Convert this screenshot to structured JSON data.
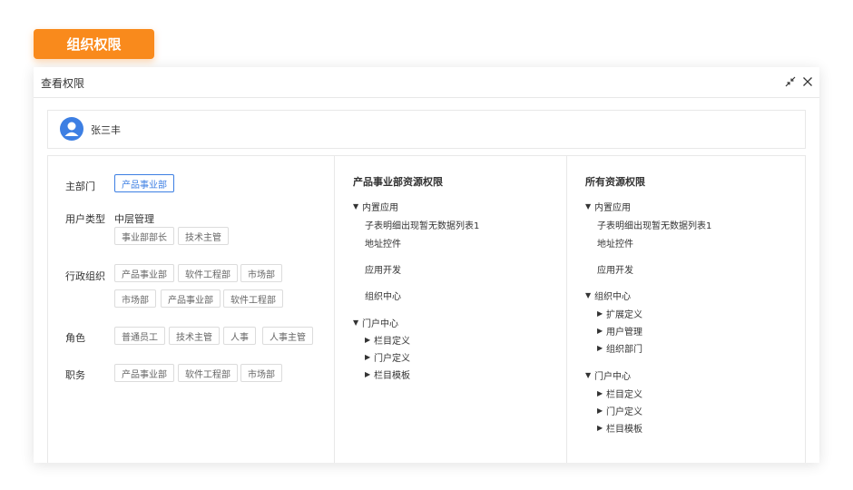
{
  "badge": {
    "label": "组织权限",
    "color": "#f98a1c"
  },
  "dialog": {
    "title": "查看权限",
    "collapse_icon": "collapse-arrows-icon",
    "close_icon": "close-icon"
  },
  "user": {
    "name": "张三丰",
    "avatar_icon": "user-avatar-icon",
    "avatar_color": "#3d7fe3"
  },
  "profile": {
    "main_dept": {
      "label": "主部门",
      "tag": "产品事业部"
    },
    "user_type": {
      "label": "用户类型",
      "value": "中层管理",
      "tags": [
        "事业部部长",
        "技术主管"
      ]
    },
    "admin_org": {
      "label": "行政组织",
      "tags": [
        "产品事业部",
        "软件工程部",
        "市场部",
        "市场部",
        "产品事业部",
        "软件工程部"
      ]
    },
    "role": {
      "label": "角色",
      "tags": [
        "普通员工",
        "技术主管",
        "人事",
        "人事主管"
      ]
    },
    "duty": {
      "label": "职务",
      "tags": [
        "产品事业部",
        "软件工程部",
        "市场部"
      ]
    }
  },
  "dept_resources": {
    "title": "产品事业部资源权限",
    "items": [
      {
        "label": "内置应用",
        "caret": "down"
      },
      {
        "label": "子表明细出现暂无数据列表1",
        "caret": ""
      },
      {
        "label": "地址控件",
        "caret": ""
      },
      {
        "label": "应用开发",
        "caret": ""
      },
      {
        "label": "组织中心",
        "caret": ""
      },
      {
        "label": "门户中心",
        "caret": "down"
      },
      {
        "label": "栏目定义",
        "caret": "right"
      },
      {
        "label": "门户定义",
        "caret": "right"
      },
      {
        "label": "栏目模板",
        "caret": "right"
      }
    ]
  },
  "all_resources": {
    "title": "所有资源权限",
    "items": [
      {
        "label": "内置应用",
        "caret": "down"
      },
      {
        "label": "子表明细出现暂无数据列表1",
        "caret": ""
      },
      {
        "label": "地址控件",
        "caret": ""
      },
      {
        "label": "应用开发",
        "caret": ""
      },
      {
        "label": "组织中心",
        "caret": "down"
      },
      {
        "label": "扩展定义",
        "caret": "right"
      },
      {
        "label": "用户管理",
        "caret": "right"
      },
      {
        "label": "组织部门",
        "caret": "right"
      },
      {
        "label": "门户中心",
        "caret": "down"
      },
      {
        "label": "栏目定义",
        "caret": "right"
      },
      {
        "label": "门户定义",
        "caret": "right"
      },
      {
        "label": "栏目模板",
        "caret": "right"
      }
    ]
  }
}
